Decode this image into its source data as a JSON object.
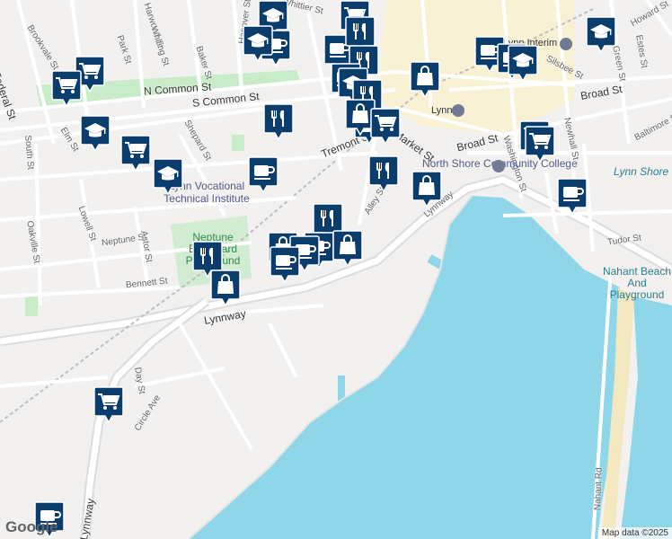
{
  "map": {
    "attribution": "Map data ©2025",
    "logo": "Google",
    "streets": [
      {
        "id": "federal-st",
        "text": "Federal St"
      },
      {
        "id": "brookvale-st",
        "text": "Brookvale St"
      },
      {
        "id": "harwood-st",
        "text": "Harwood St"
      },
      {
        "id": "park-st",
        "text": "Park St"
      },
      {
        "id": "whiting-st",
        "text": "Whiting St"
      },
      {
        "id": "baker-st",
        "text": "Baker St"
      },
      {
        "id": "hanover-st",
        "text": "Hanover St"
      },
      {
        "id": "n-common-st",
        "text": "N Common St"
      },
      {
        "id": "s-common-st",
        "text": "S Common St"
      },
      {
        "id": "shepard-st",
        "text": "Shepard St"
      },
      {
        "id": "elm-st",
        "text": "Elm St"
      },
      {
        "id": "south-st",
        "text": "South St"
      },
      {
        "id": "lowell-st",
        "text": "Lowell St"
      },
      {
        "id": "oakville-st",
        "text": "Oakville St"
      },
      {
        "id": "neptune-st",
        "text": "Neptune St"
      },
      {
        "id": "astor-st",
        "text": "Astor St"
      },
      {
        "id": "bennett-st",
        "text": "Bennett St"
      },
      {
        "id": "lynnway-main",
        "text": "Lynnway"
      },
      {
        "id": "lynnway-south",
        "text": "Lynnway"
      },
      {
        "id": "lynnway-east",
        "text": "Lynnway"
      },
      {
        "id": "day-st",
        "text": "Day St"
      },
      {
        "id": "circle-ave",
        "text": "Circle Ave"
      },
      {
        "id": "tremont-st",
        "text": "Tremont St"
      },
      {
        "id": "market-st",
        "text": "Market St"
      },
      {
        "id": "broad-st-e",
        "text": "Broad St"
      },
      {
        "id": "broad-st-w",
        "text": "Broad St"
      },
      {
        "id": "washington-st",
        "text": "Washington St"
      },
      {
        "id": "newhall-st",
        "text": "Newhall St"
      },
      {
        "id": "green-st",
        "text": "Green St"
      },
      {
        "id": "estes-st",
        "text": "Estes St"
      },
      {
        "id": "howard-st",
        "text": "Howard St"
      },
      {
        "id": "tudor-st",
        "text": "Tudor St"
      },
      {
        "id": "nahant-rd",
        "text": "Nahant Rd"
      },
      {
        "id": "alley-st",
        "text": "Alley St"
      },
      {
        "id": "silsbee-st",
        "text": "Silsbee St"
      },
      {
        "id": "whittier-st",
        "text": "Whittier St"
      },
      {
        "id": "baltimore-st",
        "text": "Baltimore St"
      }
    ],
    "places": [
      {
        "id": "north-shore-cc",
        "text": "North Shore Community College"
      },
      {
        "id": "lynn-vocational",
        "text": "Lynn Vocational Technical Institute"
      },
      {
        "id": "lynn-station",
        "text": "Lynn"
      },
      {
        "id": "lynn-interim",
        "text": "Lynn Interim"
      },
      {
        "id": "lynn-shore",
        "text": "Lynn Shore"
      },
      {
        "id": "neptune-park",
        "text": "Neptune Boulevard Playground"
      },
      {
        "id": "nahant-beach",
        "text": "Nahant Beach And Playground"
      }
    ],
    "markers": [
      {
        "icon": "school-icon"
      },
      {
        "icon": "shopping-cart-icon"
      },
      {
        "icon": "coffee-icon"
      },
      {
        "icon": "school-icon"
      },
      {
        "icon": "coffee-icon"
      },
      {
        "icon": "restaurant-icon"
      },
      {
        "icon": "school-icon"
      },
      {
        "icon": "restaurant-icon"
      },
      {
        "icon": "coffee-icon"
      },
      {
        "icon": "coffee-icon"
      },
      {
        "icon": "school-icon"
      },
      {
        "icon": "coffee-icon"
      },
      {
        "icon": "shopping-cart-icon"
      },
      {
        "icon": "shopping-cart-icon"
      },
      {
        "icon": "school-icon"
      },
      {
        "icon": "restaurant-icon"
      },
      {
        "icon": "shopping-bag-icon"
      },
      {
        "icon": "shopping-bag-icon"
      },
      {
        "icon": "shopping-cart-icon"
      },
      {
        "icon": "shopping-cart-icon"
      },
      {
        "icon": "shopping-cart-icon"
      },
      {
        "icon": "school-icon"
      },
      {
        "icon": "school-icon"
      },
      {
        "icon": "restaurant-icon"
      },
      {
        "icon": "shopping-bag-icon"
      },
      {
        "icon": "shopping-cart-icon"
      },
      {
        "icon": "restaurant-icon"
      },
      {
        "icon": "coffee-icon"
      },
      {
        "icon": "coffee-icon"
      },
      {
        "icon": "shopping-bag-icon"
      },
      {
        "icon": "restaurant-icon"
      },
      {
        "icon": "shopping-bag-icon"
      },
      {
        "icon": "coffee-icon"
      },
      {
        "icon": "shopping-cart-icon"
      },
      {
        "icon": "coffee-icon"
      }
    ],
    "colors": {
      "land": "#f2f1ef",
      "water": "#8fd7e8",
      "park": "#c8ebc8",
      "marker": "#0a3d6b",
      "road": "#ffffff",
      "highway": "#dcdcdc",
      "downtown": "#fbf1c8"
    }
  }
}
